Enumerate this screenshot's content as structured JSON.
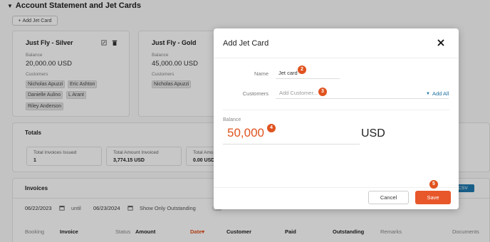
{
  "section": {
    "title": "Account Statement and Jet Cards",
    "add_button": "Add Jet Card",
    "add_icon": "plus-icon"
  },
  "jet_cards": [
    {
      "name": "Just Fly - Silver",
      "balance_label": "Balance",
      "balance": "20,000.00 USD",
      "customers_label": "Customers",
      "customers": [
        "Nicholas Apuzzi",
        "Eric Ashton",
        "Danielle Aulino",
        "L Arant",
        "Riley Anderson"
      ],
      "icons": [
        "edit-icon",
        "trash-icon"
      ]
    },
    {
      "name": "Just Fly - Gold",
      "balance_label": "Balance",
      "balance": "45,000.00 USD",
      "customers_label": "Customers",
      "customers": [
        "Nicholas Apuzzi"
      ]
    }
  ],
  "totals": {
    "title": "Totals",
    "stats": [
      {
        "label": "Total Invoices Issued",
        "value": "1"
      },
      {
        "label": "Total Amount Invoiced",
        "value": "3,774.15 USD"
      },
      {
        "label": "Total Amo",
        "value": "0.00 USD"
      }
    ]
  },
  "invoices": {
    "title": "Invoices",
    "date_from": "06/22/2023",
    "until_label": "until",
    "date_to": "06/23/2024",
    "outstanding_label": "Show Only Outstanding",
    "csv_button": "CSV",
    "columns": [
      "Booking",
      "Invoice",
      "Status",
      "Amount",
      "Date",
      "Customer",
      "Paid",
      "Outstanding",
      "Remarks",
      "Documents"
    ],
    "sort_indicator": "▾"
  },
  "modal": {
    "title": "Add Jet Card",
    "name_label": "Name",
    "name_value": "Jet card",
    "customers_label": "Customers",
    "customers_placeholder": "Add Customer...",
    "add_all": "Add All",
    "balance_label": "Balance",
    "balance_value": "50,000",
    "currency": "USD",
    "cancel": "Cancel",
    "save": "Save",
    "steps": [
      "2",
      "3",
      "4",
      "5"
    ]
  },
  "colors": {
    "accent": "#e0531f",
    "save": "#e8572a",
    "link": "#1e6f9f",
    "csv": "#1e7ab0"
  }
}
